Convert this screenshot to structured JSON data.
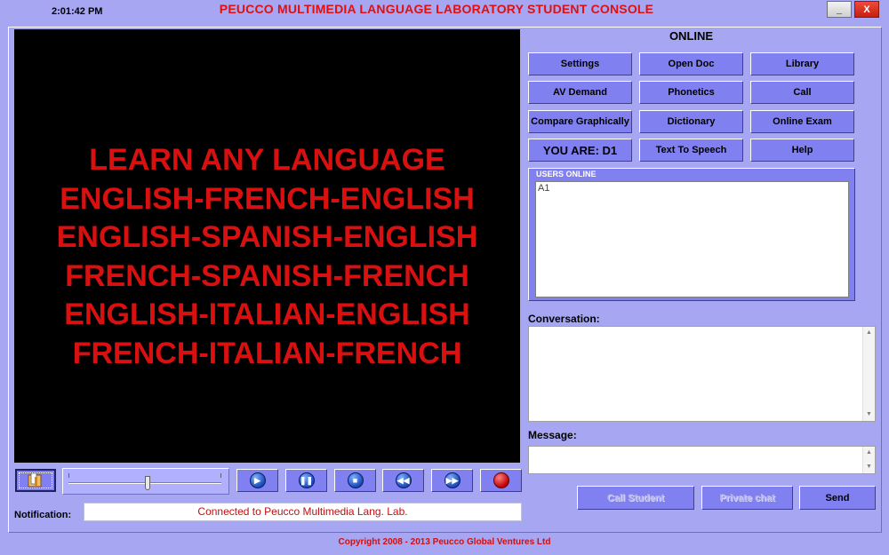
{
  "window": {
    "clock": "2:01:42 PM",
    "title": "PEUCCO MULTIMEDIA LANGUAGE LABORATORY STUDENT CONSOLE",
    "minimize_label": "_",
    "close_label": "X"
  },
  "video": {
    "lines": [
      "LEARN ANY LANGUAGE",
      "ENGLISH-FRENCH-ENGLISH",
      "ENGLISH-SPANISH-ENGLISH",
      "FRENCH-SPANISH-FRENCH",
      "ENGLISH-ITALIAN-ENGLISH",
      "FRENCH-ITALIAN-FRENCH"
    ],
    "text_color": "#d81010"
  },
  "media": {
    "slider_position_pct": 52,
    "buttons": [
      "play",
      "pause",
      "stop",
      "rewind",
      "fast-forward",
      "record"
    ]
  },
  "notification": {
    "label": "Notification:",
    "text": "Connected to Peucco Multimedia Lang. Lab."
  },
  "status": "ONLINE",
  "grid": {
    "settings": "Settings",
    "open_doc": "Open Doc",
    "library": "Library",
    "av_demand": "AV Demand",
    "phonetics": "Phonetics",
    "call": "Call",
    "compare": "Compare Graphically",
    "dictionary": "Dictionary",
    "online_exam": "Online Exam",
    "you_are": "YOU ARE: D1",
    "tts": "Text To Speech",
    "help": "Help"
  },
  "users": {
    "legend": "USERS ONLINE",
    "items": [
      "A1"
    ]
  },
  "chat": {
    "conversation_label": "Conversation:",
    "message_label": "Message:",
    "message_value": ""
  },
  "actions": {
    "call_student": "Call Student",
    "private_chat": "Private chat",
    "send": "Send"
  },
  "footer": "Copyright 2008 - 2013 Peucco Global Ventures Ltd",
  "colors": {
    "background": "#a6a6f2",
    "button": "#8080f0",
    "accent_red": "#e01010"
  }
}
